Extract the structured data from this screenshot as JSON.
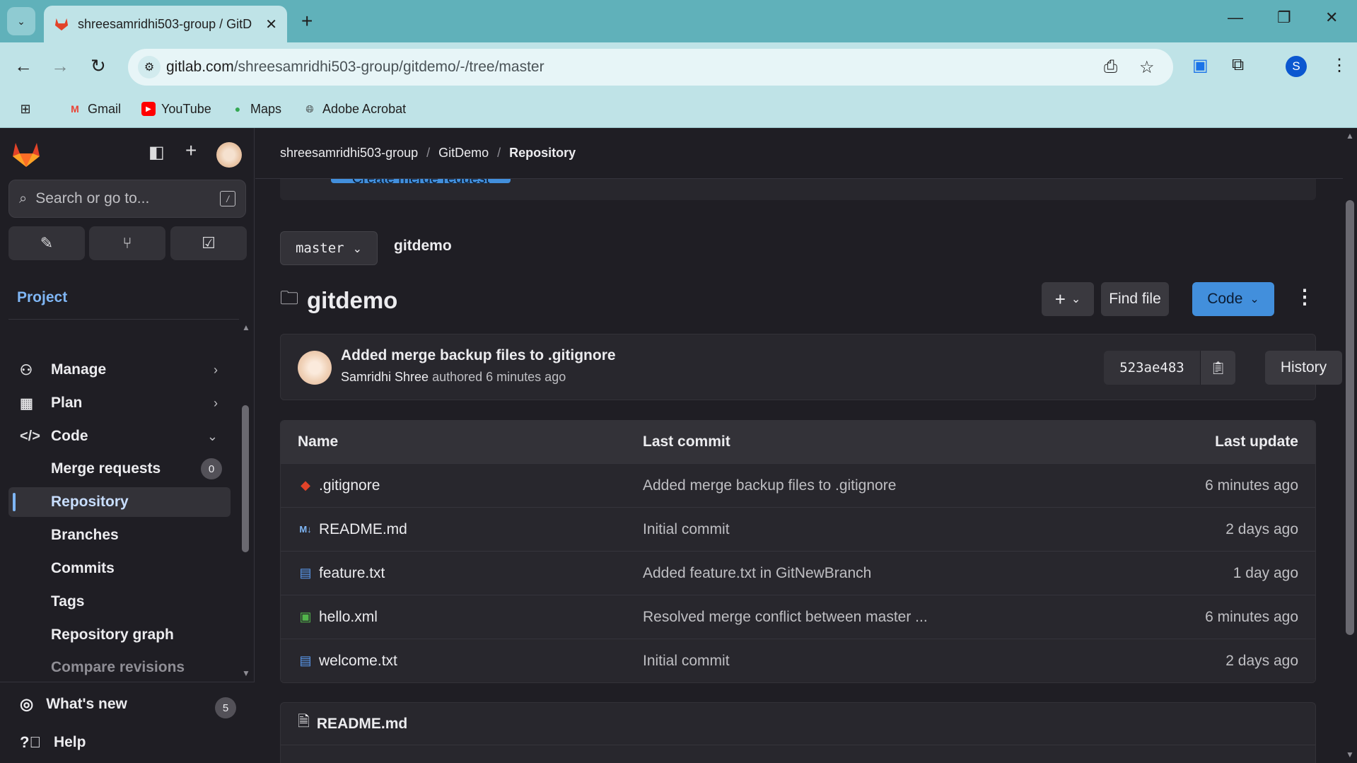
{
  "browser": {
    "tab_title": "shreesamridhi503-group / GitD",
    "url_host": "gitlab.com",
    "url_path": "/shreesamridhi503-group/gitdemo/-/tree/master",
    "profile_initial": "S",
    "bookmarks": [
      "Gmail",
      "YouTube",
      "Maps",
      "Adobe Acrobat"
    ]
  },
  "sidebar": {
    "search_placeholder": "Search or go to...",
    "search_shortcut": "/",
    "context_label": "Project",
    "nav": {
      "manage": "Manage",
      "plan": "Plan",
      "code": "Code"
    },
    "code_items": {
      "merge_requests": "Merge requests",
      "merge_requests_count": "0",
      "repository": "Repository",
      "branches": "Branches",
      "commits": "Commits",
      "tags": "Tags",
      "repository_graph": "Repository graph",
      "compare_revisions": "Compare revisions"
    },
    "whats_new": "What's new",
    "whats_new_count": "5",
    "help": "Help"
  },
  "breadcrumb": [
    "shreesamridhi503-group",
    "GitDemo",
    "Repository"
  ],
  "banner": {
    "create_mr_label": "Create merge request"
  },
  "repo": {
    "branch": "master",
    "path": "gitdemo",
    "title": "gitdemo",
    "find_file_label": "Find file",
    "code_label": "Code",
    "add_label": "+"
  },
  "last_commit": {
    "message": "Added merge backup files to .gitignore",
    "author": "Samridhi Shree",
    "time_text": "authored 6 minutes ago",
    "sha": "523ae483",
    "history_label": "History"
  },
  "files": {
    "headers": {
      "name": "Name",
      "last_commit": "Last commit",
      "last_update": "Last update"
    },
    "rows": [
      {
        "name": ".gitignore",
        "commit": "Added merge backup files to .gitignore",
        "updated": "6 minutes ago",
        "icon": "git-icon",
        "color": "#e24329"
      },
      {
        "name": "README.md",
        "commit": "Initial commit",
        "updated": "2 days ago",
        "icon": "markdown-icon",
        "color": "#7fb6f5"
      },
      {
        "name": "feature.txt",
        "commit": "Added feature.txt in GitNewBranch",
        "updated": "1 day ago",
        "icon": "file-icon",
        "color": "#5b9bf0"
      },
      {
        "name": "hello.xml",
        "commit": "Resolved merge conflict between master ...",
        "updated": "6 minutes ago",
        "icon": "xml-icon",
        "color": "#52b44b"
      },
      {
        "name": "welcome.txt",
        "commit": "Initial commit",
        "updated": "2 days ago",
        "icon": "file-icon",
        "color": "#5b9bf0"
      }
    ]
  },
  "readme": {
    "title": "README.md"
  },
  "colors": {
    "accent": "#428fdc",
    "chrome": "#bfe3e7",
    "bg": "#1f1e24"
  }
}
